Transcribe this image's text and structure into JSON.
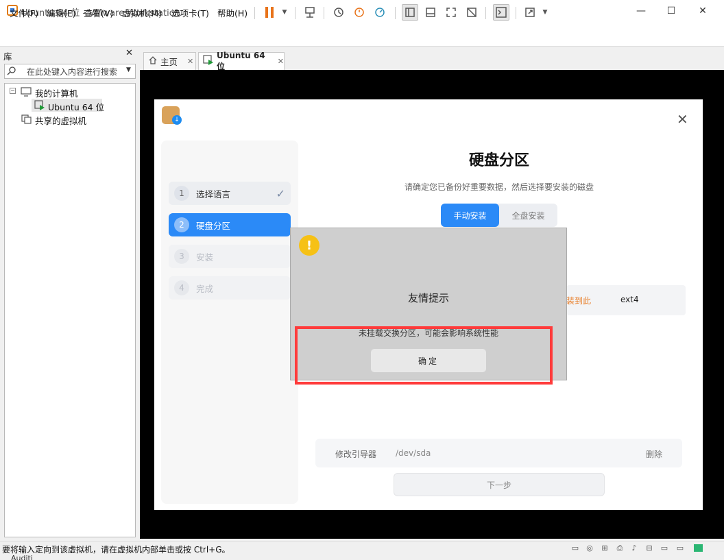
{
  "window": {
    "title": "Ubuntu 64 位 - VMware Workstation",
    "minimize": "—",
    "maximize": "☐",
    "close": "✕"
  },
  "menu": [
    "文件(F)",
    "编辑(E)",
    "查看(V)",
    "虚拟机(M)",
    "选项卡(T)",
    "帮助(H)"
  ],
  "library": {
    "title": "库",
    "close": "✕",
    "search_placeholder": "在此处键入内容进行搜索",
    "tree": {
      "my_computer": "我的计算机",
      "vm": "Ubuntu 64 位",
      "shared": "共享的虚拟机"
    }
  },
  "tabs": [
    {
      "label": "主页",
      "close": "✕"
    },
    {
      "label": "Ubuntu 64 位",
      "close": "✕"
    }
  ],
  "installer": {
    "steps": [
      {
        "num": "1",
        "label": "选择语言",
        "state": "done"
      },
      {
        "num": "2",
        "label": "硬盘分区",
        "state": "active"
      },
      {
        "num": "3",
        "label": "安装",
        "state": "pending"
      },
      {
        "num": "4",
        "label": "完成",
        "state": "pending"
      }
    ],
    "check": "✓",
    "heading": "硬盘分区",
    "subtitle": "请确定您已备份好重要数据，然后选择要安装的磁盘",
    "seg_manual": "手动安装",
    "seg_full": "全盘安装",
    "partition": {
      "install_here": "装到此",
      "fs": "ext4"
    },
    "boot": {
      "label": "修改引导器",
      "device": "/dev/sda",
      "delete": "删除"
    },
    "next": "下一步",
    "close": "✕"
  },
  "dialog": {
    "title": "友情提示",
    "message": "未挂载交换分区，可能会影响系统性能",
    "ok": "确定",
    "icon": "!"
  },
  "status": {
    "text": "要将输入定向到该虚拟机，请在虚拟机内部单击或按 Ctrl+G。",
    "extra": "Auditi"
  },
  "colors": {
    "accent": "#2b8af7",
    "warning": "#f6c116",
    "highlight": "#ff3b3b",
    "pause": "#e8731a"
  }
}
